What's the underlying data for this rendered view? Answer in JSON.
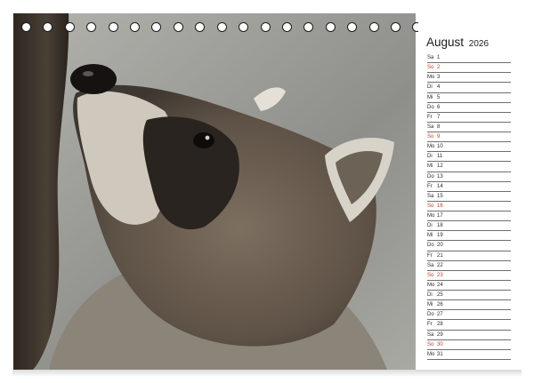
{
  "calendar": {
    "month": "August",
    "year": "2026",
    "days": [
      {
        "wd": "Sa",
        "num": "1",
        "sunday": false
      },
      {
        "wd": "So",
        "num": "2",
        "sunday": true
      },
      {
        "wd": "Mo",
        "num": "3",
        "sunday": false
      },
      {
        "wd": "Di",
        "num": "4",
        "sunday": false
      },
      {
        "wd": "Mi",
        "num": "5",
        "sunday": false
      },
      {
        "wd": "Do",
        "num": "6",
        "sunday": false
      },
      {
        "wd": "Fr",
        "num": "7",
        "sunday": false
      },
      {
        "wd": "Sa",
        "num": "8",
        "sunday": false
      },
      {
        "wd": "So",
        "num": "9",
        "sunday": true
      },
      {
        "wd": "Mo",
        "num": "10",
        "sunday": false
      },
      {
        "wd": "Di",
        "num": "11",
        "sunday": false
      },
      {
        "wd": "Mi",
        "num": "12",
        "sunday": false
      },
      {
        "wd": "Do",
        "num": "13",
        "sunday": false
      },
      {
        "wd": "Fr",
        "num": "14",
        "sunday": false
      },
      {
        "wd": "Sa",
        "num": "15",
        "sunday": false
      },
      {
        "wd": "So",
        "num": "16",
        "sunday": true
      },
      {
        "wd": "Mo",
        "num": "17",
        "sunday": false
      },
      {
        "wd": "Di",
        "num": "18",
        "sunday": false
      },
      {
        "wd": "Mi",
        "num": "19",
        "sunday": false
      },
      {
        "wd": "Do",
        "num": "20",
        "sunday": false
      },
      {
        "wd": "Fr",
        "num": "21",
        "sunday": false
      },
      {
        "wd": "Sa",
        "num": "22",
        "sunday": false
      },
      {
        "wd": "So",
        "num": "23",
        "sunday": true
      },
      {
        "wd": "Mo",
        "num": "24",
        "sunday": false
      },
      {
        "wd": "Di",
        "num": "25",
        "sunday": false
      },
      {
        "wd": "Mi",
        "num": "26",
        "sunday": false
      },
      {
        "wd": "Do",
        "num": "27",
        "sunday": false
      },
      {
        "wd": "Fr",
        "num": "28",
        "sunday": false
      },
      {
        "wd": "Sa",
        "num": "29",
        "sunday": false
      },
      {
        "wd": "So",
        "num": "30",
        "sunday": true
      },
      {
        "wd": "Mo",
        "num": "31",
        "sunday": false
      }
    ]
  },
  "binding": {
    "ring_count": 23
  },
  "colors": {
    "sunday": "#c0392b",
    "text": "#2a2a2a",
    "rule": "#6e6e6e"
  },
  "photo": {
    "subject": "raccoon-photo"
  }
}
